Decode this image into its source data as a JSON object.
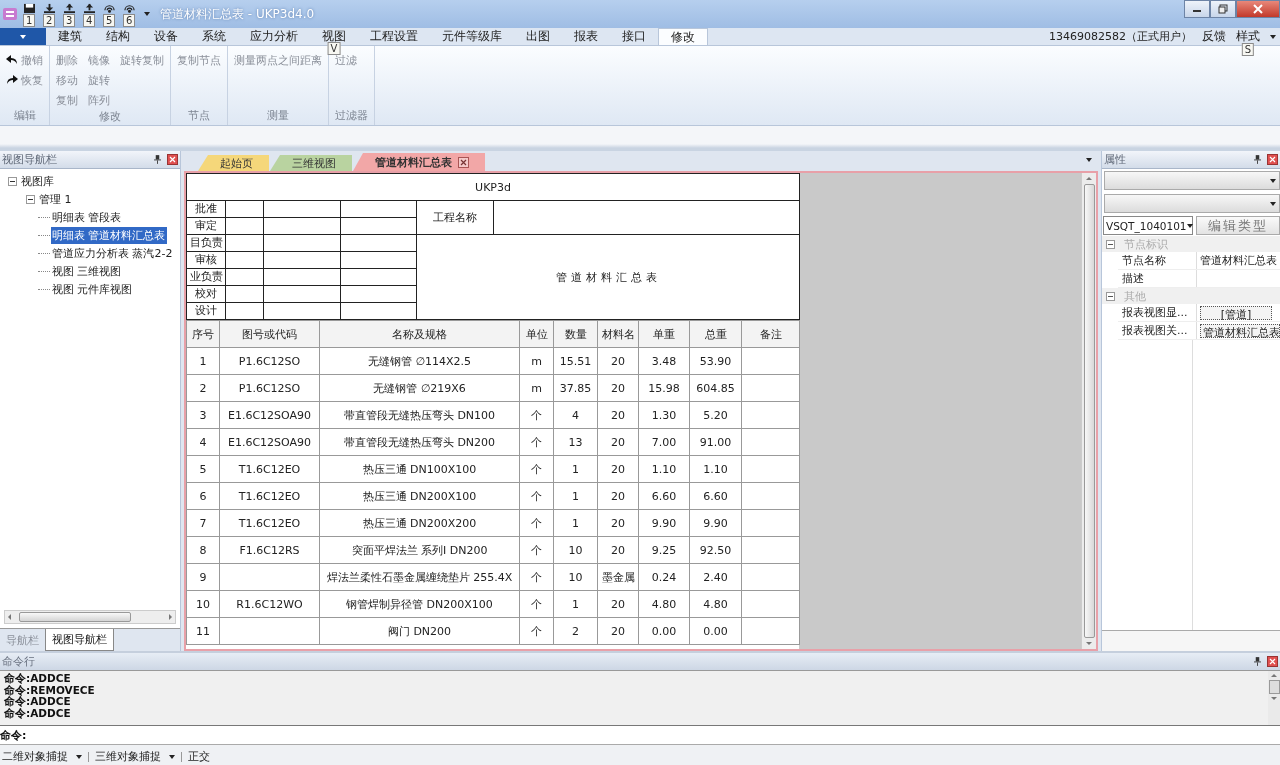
{
  "title_bar": {
    "title": "管道材料汇总表 - UKP3d4.0",
    "keytips": [
      "1",
      "2",
      "3",
      "4",
      "5",
      "6"
    ]
  },
  "menu": {
    "tabs": [
      {
        "label": "建筑",
        "selected": false
      },
      {
        "label": "结构",
        "selected": false
      },
      {
        "label": "设备",
        "selected": false
      },
      {
        "label": "系统",
        "selected": false
      },
      {
        "label": "应力分析",
        "selected": false
      },
      {
        "label": "视图",
        "selected": false,
        "keytip": "V"
      },
      {
        "label": "工程设置",
        "selected": false
      },
      {
        "label": "元件等级库",
        "selected": false
      },
      {
        "label": "出图",
        "selected": false
      },
      {
        "label": "报表",
        "selected": false
      },
      {
        "label": "接口",
        "selected": false
      },
      {
        "label": "修改",
        "selected": true
      }
    ],
    "account": "13469082582（正式用户）",
    "feedback": "反馈",
    "style": "样式",
    "style_keytip": "S"
  },
  "ribbon": {
    "groups": [
      {
        "label": "编辑",
        "rows": [
          [
            "撤销"
          ],
          [
            "恢复"
          ]
        ]
      },
      {
        "label": "修改",
        "rows": [
          [
            "删除",
            "镜像",
            "旋转复制"
          ],
          [
            "移动",
            "旋转"
          ],
          [
            "复制",
            "阵列"
          ]
        ]
      },
      {
        "label": "节点",
        "rows": [
          [
            "复制节点"
          ]
        ]
      },
      {
        "label": "测量",
        "rows": [
          [
            "测量两点之间距离"
          ]
        ]
      },
      {
        "label": "过滤器",
        "rows": [
          [
            "过滤"
          ]
        ]
      }
    ]
  },
  "left_panel": {
    "title": "视图导航栏",
    "tree": [
      {
        "label": "视图库",
        "expanded": true,
        "children": [
          {
            "label": "管理 1",
            "expanded": true,
            "children": [
              {
                "label": "明细表 管段表",
                "selected": false
              },
              {
                "label": "明细表 管道材料汇总表",
                "selected": true
              },
              {
                "label": "管道应力分析表 蒸汽2-2",
                "selected": false
              },
              {
                "label": "视图 三维视图",
                "selected": false
              },
              {
                "label": "视图 元件库视图",
                "selected": false
              }
            ]
          }
        ]
      }
    ],
    "tabs": [
      {
        "label": "导航栏",
        "selected": false
      },
      {
        "label": "视图导航栏",
        "selected": true
      }
    ]
  },
  "document_tabs": [
    {
      "label": "起始页",
      "color": "#f5d77a",
      "selected": false
    },
    {
      "label": "三维视图",
      "color": "#b9d3a0",
      "selected": false
    },
    {
      "label": "管道材料汇总表",
      "color": "#f2a7a7",
      "selected": true
    }
  ],
  "report": {
    "title": "UKP3d",
    "sign_rows": [
      "批准",
      "审定",
      "目负责",
      "审核",
      "业负责",
      "校对",
      "设计"
    ],
    "project_label": "工程名称",
    "report_name": "管道材料汇总表",
    "columns": [
      "序号",
      "图号或代码",
      "名称及规格",
      "单位",
      "数量",
      "材料名",
      "单重",
      "总重",
      "备注"
    ],
    "rows": [
      [
        "1",
        "P1.6C12SO",
        "无缝钢管 ∅114X2.5",
        "m",
        "15.51",
        "20",
        "3.48",
        "53.90"
      ],
      [
        "2",
        "P1.6C12SO",
        "无缝钢管 ∅219X6",
        "m",
        "37.85",
        "20",
        "15.98",
        "604.85"
      ],
      [
        "3",
        "E1.6C12SOA90",
        "带直管段无缝热压弯头 DN100",
        "个",
        "4",
        "20",
        "1.30",
        "5.20"
      ],
      [
        "4",
        "E1.6C12SOA90",
        "带直管段无缝热压弯头 DN200",
        "个",
        "13",
        "20",
        "7.00",
        "91.00"
      ],
      [
        "5",
        "T1.6C12EO",
        "热压三通 DN100X100",
        "个",
        "1",
        "20",
        "1.10",
        "1.10"
      ],
      [
        "6",
        "T1.6C12EO",
        "热压三通 DN200X100",
        "个",
        "1",
        "20",
        "6.60",
        "6.60"
      ],
      [
        "7",
        "T1.6C12EO",
        "热压三通 DN200X200",
        "个",
        "1",
        "20",
        "9.90",
        "9.90"
      ],
      [
        "8",
        "F1.6C12RS",
        "突面平焊法兰 系列Ⅰ DN200",
        "个",
        "10",
        "20",
        "9.25",
        "92.50"
      ],
      [
        "9",
        "",
        "焊法兰柔性石墨金属缠绕垫片 255.4X",
        "个",
        "10",
        "墨金属",
        "0.24",
        "2.40"
      ],
      [
        "10",
        "R1.6C12WO",
        "钢管焊制异径管 DN200X100",
        "个",
        "1",
        "20",
        "4.80",
        "4.80"
      ],
      [
        "11",
        "",
        "阀门 DN200",
        "个",
        "2",
        "20",
        "0.00",
        "0.00"
      ]
    ]
  },
  "properties": {
    "title": "属性",
    "type_combo": "VSQT_1040101",
    "edit_type_button": "编辑类型",
    "groups": [
      {
        "label": "节点标识",
        "expanded": true,
        "rows": [
          {
            "name": "节点名称",
            "value": "管道材料汇总表",
            "kind": "text"
          },
          {
            "name": "描述",
            "kind": "text"
          }
        ]
      },
      {
        "label": "其他",
        "expanded": true,
        "rows": [
          {
            "name": "报表视图显...",
            "value": "[管道]",
            "kind": "button"
          },
          {
            "name": "报表视图关...",
            "value": "管道材料汇总表",
            "kind": "button"
          }
        ]
      }
    ]
  },
  "command": {
    "title": "命令行",
    "history": [
      "命令:ADDCE",
      "命令:REMOVECE",
      "命令:ADDCE",
      "命令:ADDCE"
    ],
    "prompt": "命令:"
  },
  "status_bar": [
    {
      "label": "二维对象捕捉",
      "dropdown": true
    },
    {
      "label": "三维对象捕捉",
      "dropdown": true
    },
    {
      "label": "正交",
      "dropdown": false
    }
  ]
}
